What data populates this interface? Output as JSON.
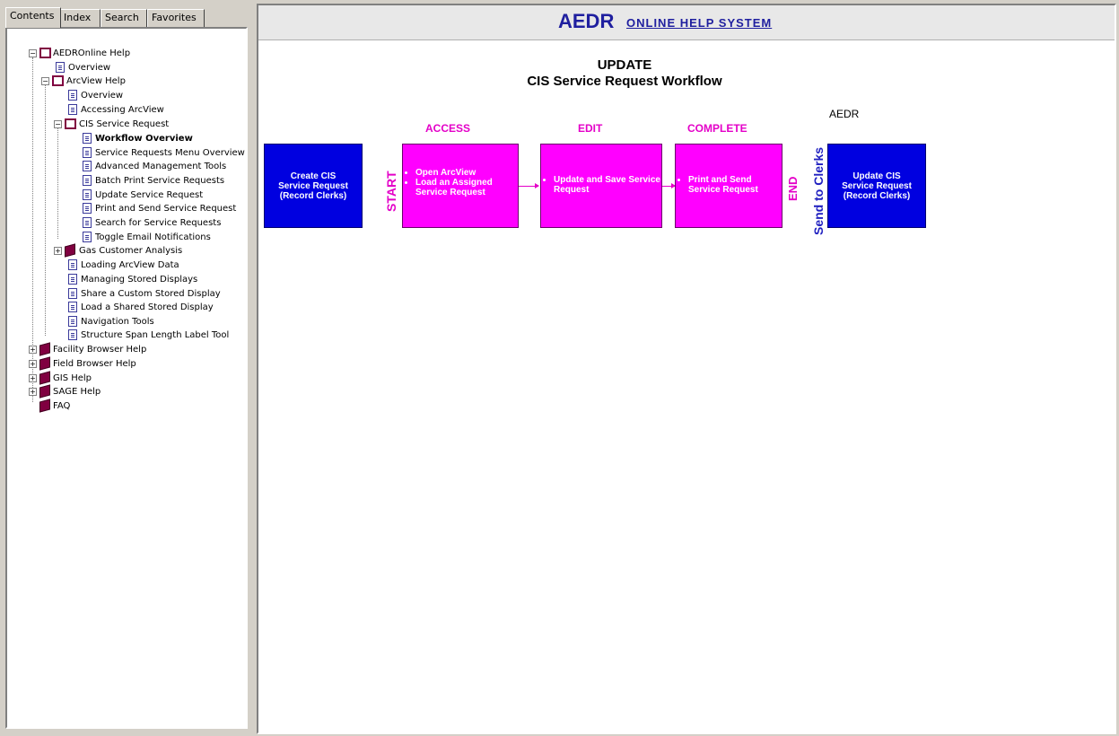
{
  "nav": {
    "tabs": [
      "Contents",
      "Index",
      "Search",
      "Favorites"
    ],
    "tree": [
      {
        "label": "AEDROnline Help",
        "icon": "open-book-icon"
      },
      {
        "label": "Overview",
        "icon": "page-icon"
      },
      {
        "label": "ArcView Help",
        "icon": "open-book-icon"
      },
      {
        "label": "Overview",
        "icon": "page-icon"
      },
      {
        "label": "Accessing ArcView",
        "icon": "page-icon"
      },
      {
        "label": "CIS Service Request",
        "icon": "open-book-icon"
      },
      {
        "label": "Workflow Overview",
        "icon": "page-icon"
      },
      {
        "label": "Service Requests Menu Overview",
        "icon": "page-icon"
      },
      {
        "label": "Advanced Management Tools",
        "icon": "page-icon"
      },
      {
        "label": "Batch Print Service Requests",
        "icon": "page-icon"
      },
      {
        "label": "Update Service Request",
        "icon": "page-icon"
      },
      {
        "label": "Print and Send Service Request",
        "icon": "page-icon"
      },
      {
        "label": "Search for Service Requests",
        "icon": "page-icon"
      },
      {
        "label": "Toggle Email Notifications",
        "icon": "page-icon"
      },
      {
        "label": "Gas Customer Analysis",
        "icon": "book-icon"
      },
      {
        "label": "Loading ArcView Data",
        "icon": "page-icon"
      },
      {
        "label": "Managing Stored Displays",
        "icon": "page-icon"
      },
      {
        "label": "Share a Custom Stored Display",
        "icon": "page-icon"
      },
      {
        "label": "Load a Shared Stored Display",
        "icon": "page-icon"
      },
      {
        "label": "Navigation Tools",
        "icon": "page-icon"
      },
      {
        "label": "Structure Span Length Label Tool",
        "icon": "page-icon"
      },
      {
        "label": "Facility Browser Help",
        "icon": "book-icon"
      },
      {
        "label": "Field Browser Help",
        "icon": "book-icon"
      },
      {
        "label": "GIS Help",
        "icon": "book-icon"
      },
      {
        "label": "SAGE Help",
        "icon": "book-icon"
      },
      {
        "label": "FAQ",
        "icon": "book-icon"
      }
    ]
  },
  "banner": {
    "aedr": "AEDR",
    "rest": "ONLINE HELP SYSTEM"
  },
  "diagram": {
    "title_line1": "UPDATE",
    "title_line2": "CIS Service Request Workflow",
    "aedr_label": "AEDR",
    "phases": {
      "access": "ACCESS",
      "edit": "EDIT",
      "complete": "COMPLETE"
    },
    "start": "START",
    "end": "END",
    "send_to_clerks": "Send to Clerks",
    "box_create": [
      "Create CIS",
      "Service Request",
      "(Record Clerks)"
    ],
    "box_access": [
      "Open ArcView",
      "Load an Assigned Service Request"
    ],
    "box_edit": [
      "Update and Save Service Request"
    ],
    "box_complete": [
      "Print and Send Service Request"
    ],
    "box_update": [
      "Update CIS",
      "Service Request",
      "(Record Clerks)"
    ]
  },
  "colors": {
    "accent_blue": "#0000e0",
    "accent_magenta": "#ff00ff",
    "banner_blue": "#1f1f9f",
    "phase_magenta": "#e400c8"
  }
}
